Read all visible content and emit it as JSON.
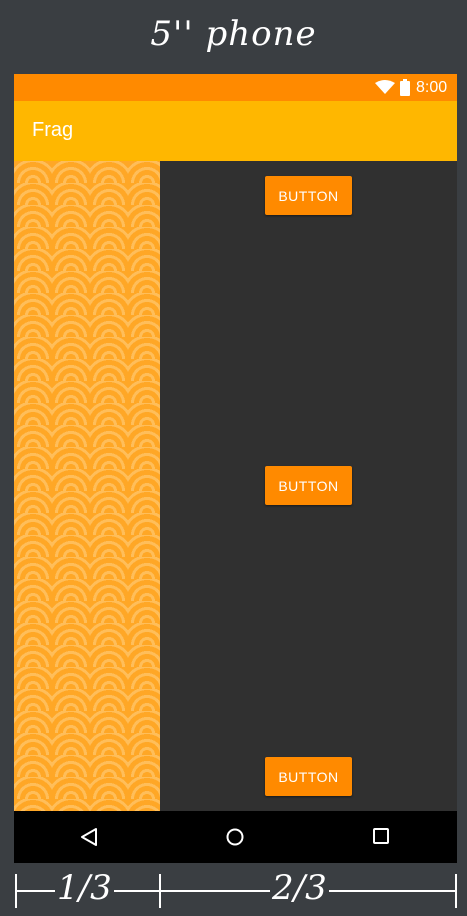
{
  "frame": {
    "title": "5'' phone"
  },
  "status_bar": {
    "time": "8:00",
    "icons": [
      "wifi-icon",
      "battery-icon"
    ]
  },
  "app_bar": {
    "title": "Frag"
  },
  "buttons": [
    {
      "label": "BUTTON"
    },
    {
      "label": "BUTTON"
    },
    {
      "label": "BUTTON"
    }
  ],
  "nav_bar": {
    "icons": [
      "back-icon",
      "home-icon",
      "recent-apps-icon"
    ]
  },
  "measure": {
    "left_label": "1/3",
    "right_label": "2/3"
  },
  "colors": {
    "status_bar": "#ff8a00",
    "app_bar": "#ffb700",
    "accent": "#ff8a00",
    "pattern": "#ffa726",
    "content_bg": "#303030",
    "outer_bg": "#3a3e42"
  }
}
